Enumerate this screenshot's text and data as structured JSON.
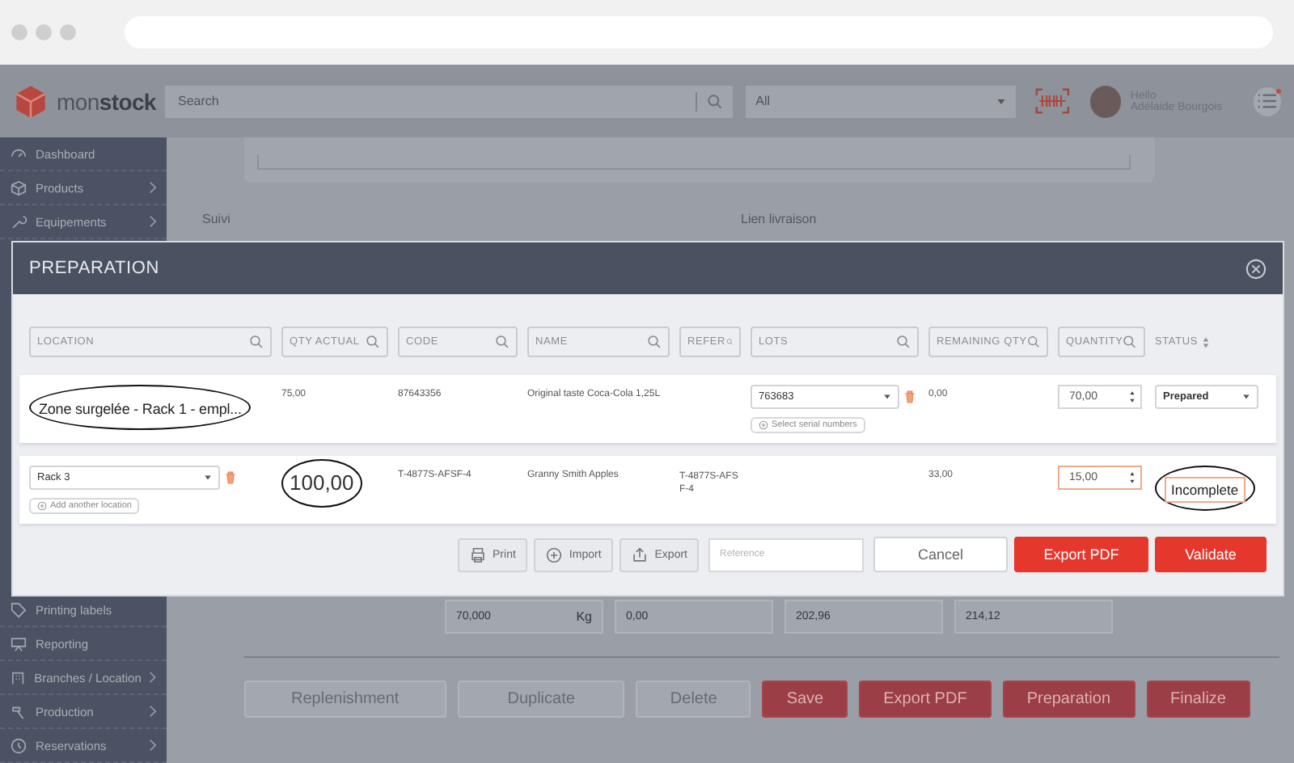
{
  "header": {
    "logo": "mon**stock**",
    "search": {
      "placeholder": "Search"
    },
    "filter": {
      "value": "All"
    },
    "greeting": "Hello",
    "user": "Adélaide Bourgois",
    "notification": true
  },
  "sidebar": {
    "items_top": [
      {
        "label": "Dashboard",
        "expandable": false
      },
      {
        "label": "Products",
        "expandable": true
      },
      {
        "label": "Equipements",
        "expandable": true
      }
    ],
    "items_bottom": [
      {
        "label": "Printing labels",
        "expandable": false
      },
      {
        "label": "Reporting",
        "expandable": false
      },
      {
        "label": "Branches / Location",
        "expandable": true
      },
      {
        "label": "Production",
        "expandable": true
      },
      {
        "label": "Reservations",
        "expandable": true
      }
    ]
  },
  "page": {
    "labels": [
      "Suivi",
      "Lien livraison"
    ],
    "totals": [
      {
        "value": "70,000",
        "unit": "Kg"
      },
      {
        "value": "0,00"
      },
      {
        "value": "202,96"
      },
      {
        "value": "214,12"
      }
    ],
    "buttons": [
      {
        "label": "Replenishment",
        "kind": "secondary"
      },
      {
        "label": "Duplicate",
        "kind": "secondary"
      },
      {
        "label": "Delete",
        "kind": "secondary"
      },
      {
        "label": "Save",
        "kind": "primary"
      },
      {
        "label": "Export PDF",
        "kind": "primary"
      },
      {
        "label": "Preparation",
        "kind": "primary"
      },
      {
        "label": "Finalize",
        "kind": "primary"
      }
    ]
  },
  "modal": {
    "title": "PREPARATION",
    "columns": [
      {
        "label": "LOCATION",
        "kind": "filter"
      },
      {
        "label": "QTY ACTUAL",
        "kind": "filter"
      },
      {
        "label": "CODE",
        "kind": "filter"
      },
      {
        "label": "NAME",
        "kind": "filter"
      },
      {
        "label": "REFER",
        "kind": "filter"
      },
      {
        "label": "LOTS",
        "kind": "filter"
      },
      {
        "label": "REMAINING QTY",
        "kind": "filter"
      },
      {
        "label": "QUANTITY",
        "kind": "filter"
      },
      {
        "label": "STATUS",
        "kind": "sort"
      }
    ],
    "rows": [
      {
        "location": {
          "value": "Zone surgelée - Rack 1 - empl...",
          "circled": true
        },
        "qty_actual": {
          "value": "75,00",
          "circled": false
        },
        "code": "87643356",
        "name": "Original taste Coca-Cola 1,25L",
        "lot": {
          "value": "763683",
          "action": "Select serial numbers"
        },
        "remaining": "0,00",
        "quantity": {
          "value": "70,00",
          "invalid": false
        },
        "status": {
          "value": "Prepared",
          "kind": "select",
          "circled": false
        }
      },
      {
        "location": {
          "value": "Rack 3",
          "circled": false,
          "action": "Add another location"
        },
        "qty_actual": {
          "value": "100,00",
          "circled": true
        },
        "code": "T-4877S-AFSF-4",
        "name": "Granny Smith Apples",
        "reference": "T-4877S-AFSF-4",
        "remaining": "33,00",
        "quantity": {
          "value": "15,00",
          "invalid": true
        },
        "status": {
          "value": "Incomplete",
          "kind": "warning",
          "circled": true
        }
      }
    ],
    "tools": [
      {
        "label": "Print"
      },
      {
        "label": "Import"
      },
      {
        "label": "Export"
      }
    ],
    "reference": {
      "placeholder": "Reference"
    },
    "buttons": [
      {
        "label": "Cancel",
        "kind": "secondary"
      },
      {
        "label": "Export PDF",
        "kind": "primary"
      },
      {
        "label": "Validate",
        "kind": "primary"
      }
    ]
  }
}
